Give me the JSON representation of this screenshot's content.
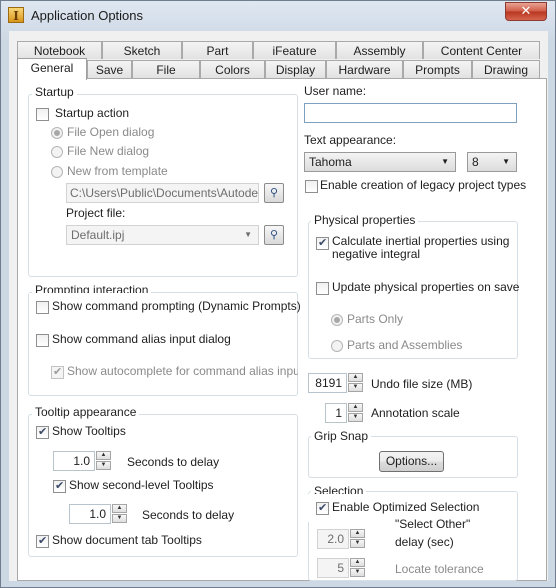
{
  "window": {
    "title": "Application Options",
    "close_glyph": "✕",
    "app_icon_letter": "I"
  },
  "tabs": {
    "row1": [
      "Notebook",
      "Sketch",
      "Part",
      "iFeature",
      "Assembly",
      "Content Center"
    ],
    "row2": [
      "General",
      "Save",
      "File",
      "Colors",
      "Display",
      "Hardware",
      "Prompts",
      "Drawing"
    ],
    "active": "General"
  },
  "startup": {
    "group_label": "Startup",
    "startup_action": "Startup action",
    "radio_open": "File Open dialog",
    "radio_new": "File New dialog",
    "radio_template": "New from template",
    "template_path": "C:\\Users\\Public\\Documents\\Autodesk\\I",
    "project_file_label": "Project file:",
    "project_file_value": "Default.ipj"
  },
  "prompting": {
    "group_label": "Prompting interaction",
    "show_command_prompting": "Show command prompting (Dynamic Prompts)",
    "show_alias_dialog": "Show command alias input dialog",
    "show_autocomplete": "Show autocomplete for command alias input"
  },
  "tooltip": {
    "group_label": "Tooltip appearance",
    "show_tooltips": "Show Tooltips",
    "seconds1_value": "1.0",
    "seconds_label": "Seconds to delay",
    "show_second_level": "Show second-level Tooltips",
    "seconds2_value": "1.0",
    "show_document_tab": "Show document tab Tooltips"
  },
  "right": {
    "user_name_label": "User name:",
    "user_name_value": "",
    "text_appearance_label": "Text appearance:",
    "font_value": "Tahoma",
    "font_size_value": "8",
    "legacy_project_types": "Enable creation of legacy project types"
  },
  "physical": {
    "group_label": "Physical properties",
    "calc_inertial": "Calculate inertial properties using negative integral",
    "update_on_save": "Update physical properties on save",
    "parts_only": "Parts Only",
    "parts_and_assemblies": "Parts and Assemblies"
  },
  "undo": {
    "value": "8191",
    "label": "Undo file size (MB)"
  },
  "annotation": {
    "value": "1",
    "label": "Annotation scale"
  },
  "grip_snap": {
    "group_label": "Grip Snap",
    "options_button": "Options..."
  },
  "selection": {
    "group_label": "Selection",
    "enable_optimized": "Enable Optimized Selection",
    "select_other_value": "2.0",
    "select_other_label_line1": "\"Select Other\"",
    "select_other_label_line2": "delay (sec)",
    "locate_value": "5",
    "locate_label": "Locate tolerance"
  },
  "icons": {
    "browse": "folder-binoculars-icon",
    "checkmark": "check-icon",
    "dropdown": "chevron-down-icon"
  }
}
